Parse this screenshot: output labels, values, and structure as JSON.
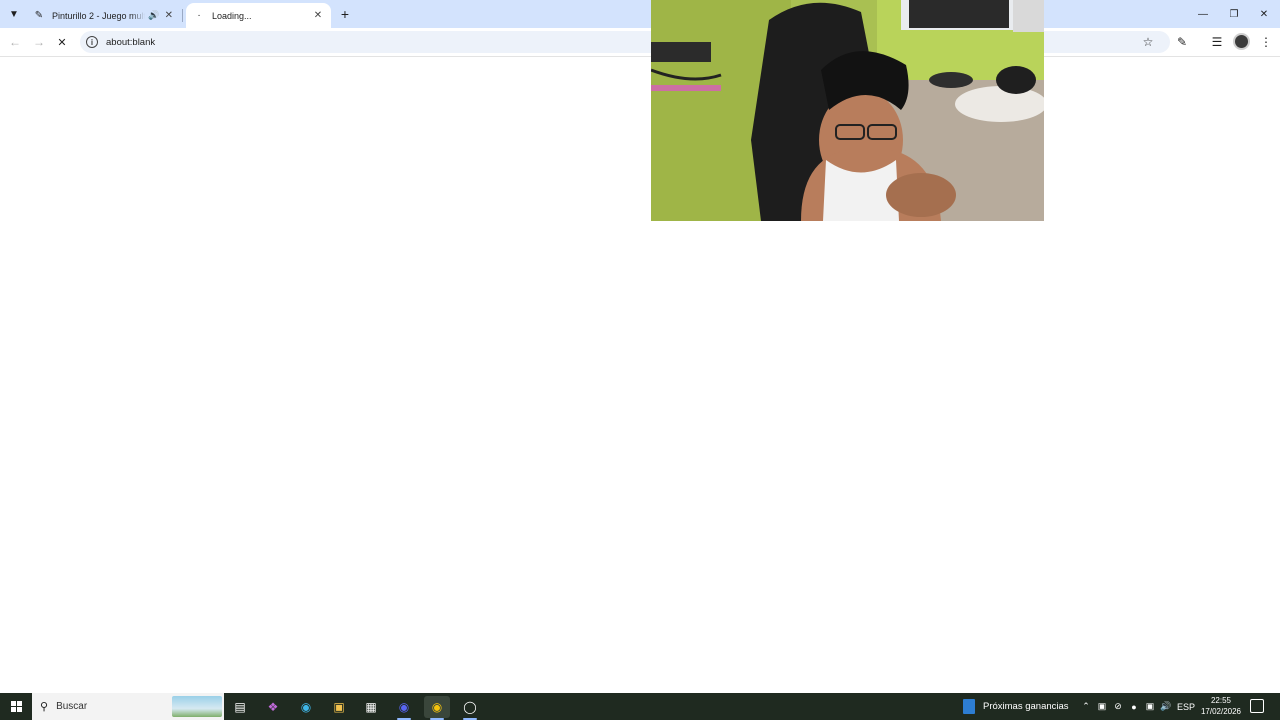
{
  "browser": {
    "tabs": [
      {
        "title": "Pinturillo 2 - Juego multijugador",
        "favicon": "pencil-icon",
        "audio": true,
        "active": false
      },
      {
        "title": "Loading...",
        "favicon": "spinner-icon",
        "active": true
      }
    ],
    "address_bar": {
      "url": "about:blank"
    }
  },
  "taskbar": {
    "search_placeholder": "Buscar",
    "weather_label": "Próximas ganancias",
    "language": "ESP",
    "time": "22:55",
    "date": "17/02/2026"
  },
  "colors": {
    "tabstrip": "#d3e3fd",
    "omnibox": "#edf2fa",
    "taskbar": "#1f2a20"
  }
}
